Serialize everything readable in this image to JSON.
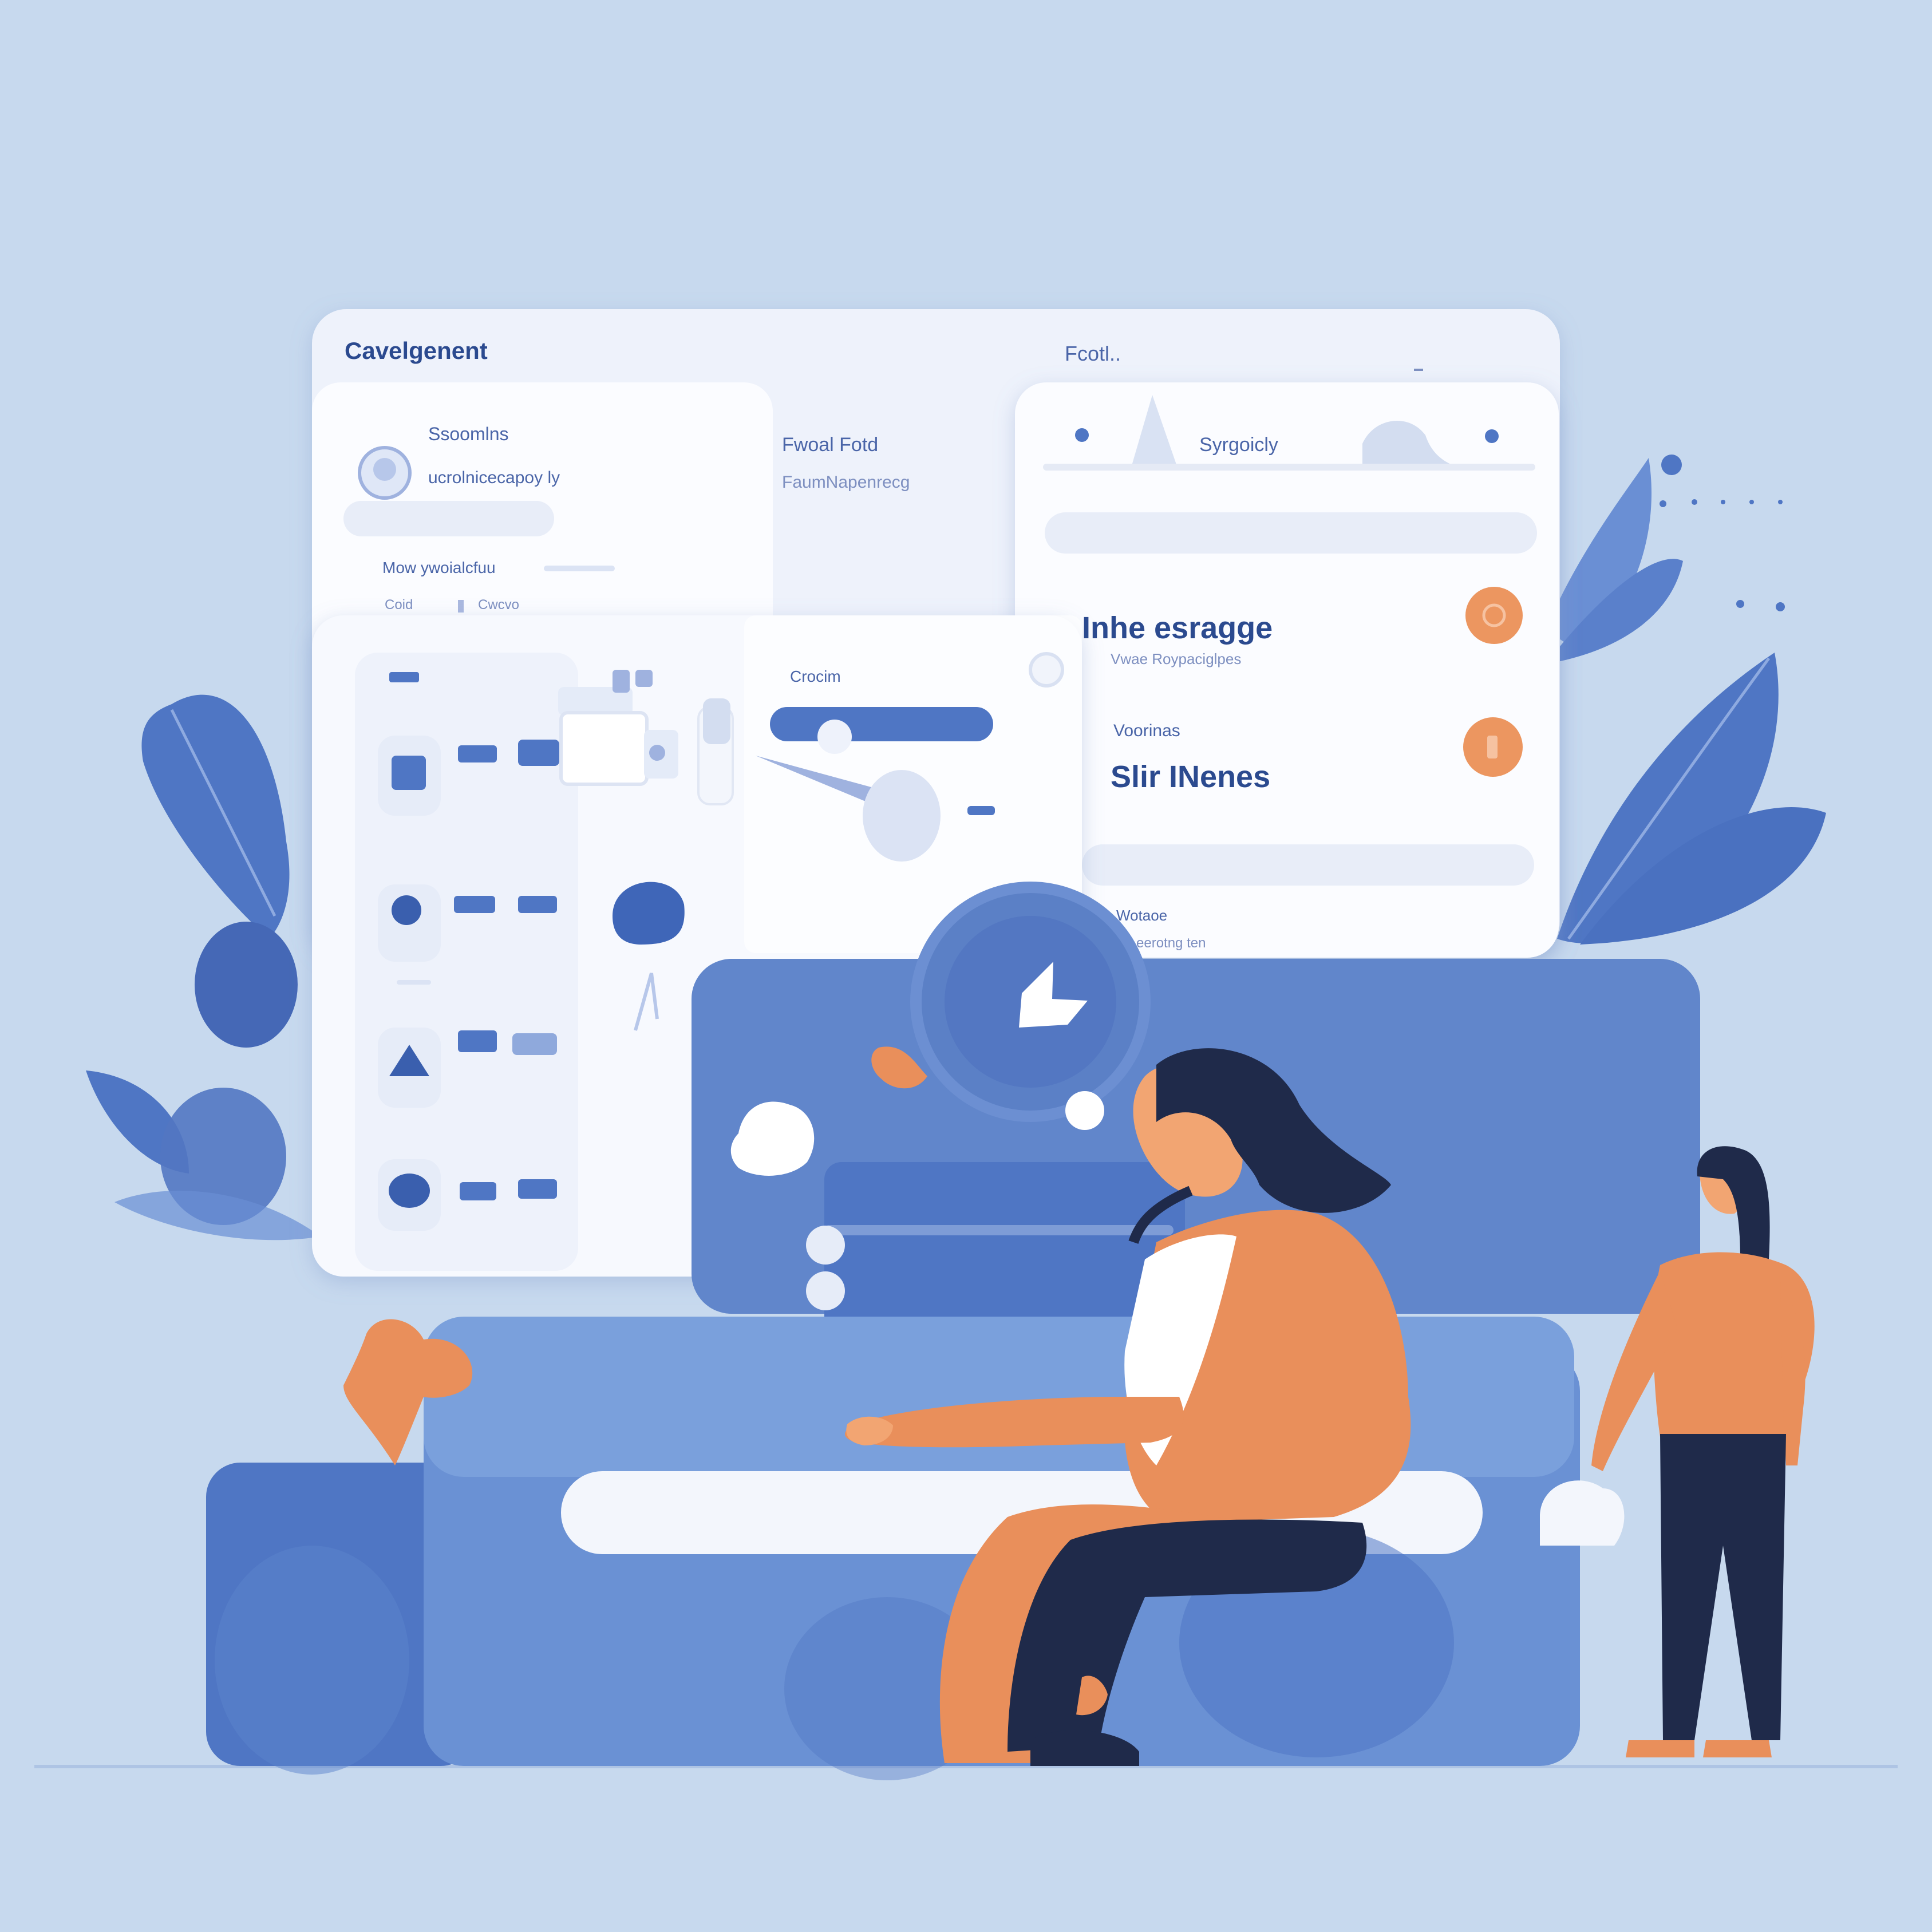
{
  "colors": {
    "background": "#c7d9ee",
    "panel": "#f7f9fe",
    "accent_blue": "#4f76c4",
    "deep_blue": "#3a5fae",
    "orange": "#e98f5b",
    "navy": "#1f2a4a"
  },
  "back_window": {
    "title": "Cavelgenent",
    "title_right": "Fcotl.."
  },
  "profile_card": {
    "heading": "Ssoomlns",
    "subtitle": "ucrolnicecapoy ly",
    "row_label": "Mow ywoialcfuu",
    "tag_1": "Coid",
    "tag_2": "Cwcvo"
  },
  "middle_card": {
    "line_1": "Fwoal Fotd",
    "line_2": "FaumNapenrecg"
  },
  "right_card": {
    "header_label": "Syrgoicly",
    "heading_1": "Inhe esragge",
    "subtitle_1": "Vwae Roypaciglpes",
    "label_2": "Voorinas",
    "heading_2": "Slir INenes",
    "footer_1": "Wotaoe",
    "footer_2": "eerotng ten"
  },
  "front_window": {
    "label": "Crocim"
  },
  "icons": [
    "chat-bubble-icon",
    "send-icon",
    "avatar-icon",
    "leaf-icon",
    "toggle-icon"
  ]
}
